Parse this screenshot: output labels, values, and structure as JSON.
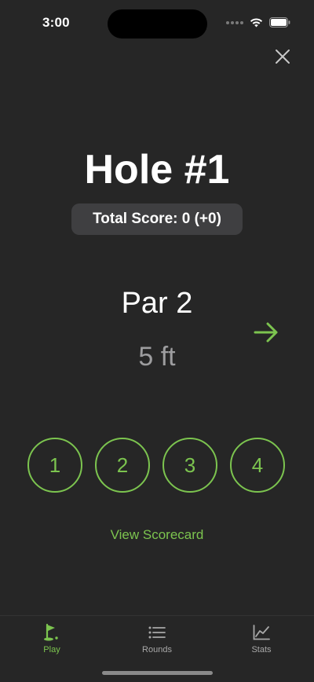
{
  "status_bar": {
    "time": "3:00"
  },
  "header": {
    "close_icon": "close-icon"
  },
  "hole": {
    "title": "Hole #1",
    "total_score": "Total Score: 0 (+0)",
    "par": "Par 2",
    "distance": "5 ft",
    "next_icon": "arrow-right-icon"
  },
  "score_options": [
    "1",
    "2",
    "3",
    "4"
  ],
  "links": {
    "view_scorecard": "View Scorecard"
  },
  "tabs": [
    {
      "label": "Play",
      "icon": "golf-flag-icon",
      "active": true
    },
    {
      "label": "Rounds",
      "icon": "list-icon",
      "active": false
    },
    {
      "label": "Stats",
      "icon": "chart-icon",
      "active": false
    }
  ],
  "colors": {
    "background": "#262626",
    "accent": "#7cc44f",
    "pill": "#3f3f41",
    "muted_text": "#9d9d9f",
    "inactive_tab": "#a8a8a8"
  }
}
